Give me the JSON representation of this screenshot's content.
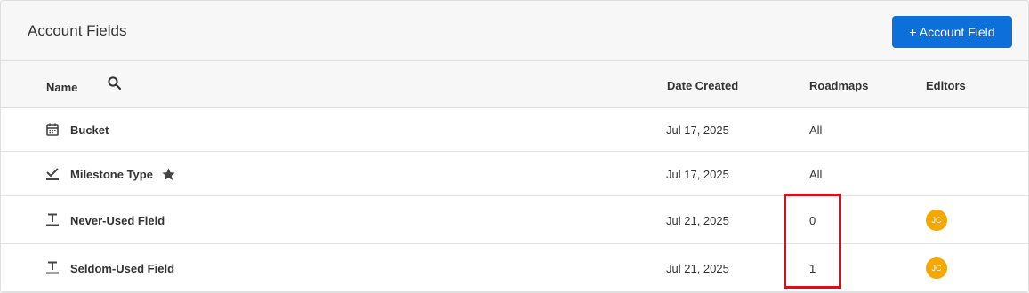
{
  "header": {
    "title": "Account Fields",
    "add_button_label": "+ Account Field"
  },
  "table": {
    "columns": {
      "name": "Name",
      "date_created": "Date Created",
      "roadmaps": "Roadmaps",
      "editors": "Editors"
    },
    "rows": [
      {
        "icon": "calendar-icon",
        "name": "Bucket",
        "starred": false,
        "date": "Jul 17, 2025",
        "roadmaps": "All",
        "editor": ""
      },
      {
        "icon": "milestone-check-icon",
        "name": "Milestone Type",
        "starred": true,
        "date": "Jul 17, 2025",
        "roadmaps": "All",
        "editor": ""
      },
      {
        "icon": "text-field-icon",
        "name": "Never-Used Field",
        "starred": false,
        "date": "Jul 21, 2025",
        "roadmaps": "0",
        "editor": "JC"
      },
      {
        "icon": "text-field-icon",
        "name": "Seldom-Used Field",
        "starred": false,
        "date": "Jul 21, 2025",
        "roadmaps": "1",
        "editor": "JC"
      }
    ]
  },
  "colors": {
    "accent": "#0d6fd9",
    "avatar": "#f5a800",
    "highlight": "#d8101c"
  }
}
